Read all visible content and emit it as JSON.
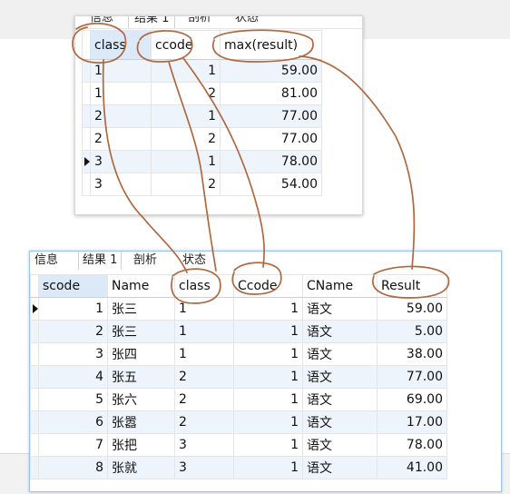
{
  "top_result": {
    "tabs": [
      "信息",
      "结果 1",
      "剖析",
      "状态"
    ],
    "columns": [
      "class",
      "ccode",
      "max(result)"
    ],
    "rows": [
      [
        "1",
        "1",
        "59.00"
      ],
      [
        "1",
        "2",
        "81.00"
      ],
      [
        "2",
        "1",
        "77.00"
      ],
      [
        "2",
        "2",
        "77.00"
      ],
      [
        "3",
        "1",
        "78.00"
      ],
      [
        "3",
        "2",
        "54.00"
      ]
    ],
    "current_row_index": 4
  },
  "bottom_result": {
    "tabs": [
      "信息",
      "结果 1",
      "剖析",
      "状态"
    ],
    "columns": [
      "scode",
      "Name",
      "class",
      "Ccode",
      "CName",
      "Result"
    ],
    "rows": [
      [
        "1",
        "张三",
        "1",
        "1",
        "语文",
        "59.00"
      ],
      [
        "2",
        "张三",
        "1",
        "1",
        "语文",
        "5.00"
      ],
      [
        "3",
        "张四",
        "1",
        "1",
        "语文",
        "38.00"
      ],
      [
        "4",
        "张五",
        "2",
        "1",
        "语文",
        "77.00"
      ],
      [
        "5",
        "张六",
        "2",
        "1",
        "语文",
        "69.00"
      ],
      [
        "6",
        "张嚣",
        "2",
        "1",
        "语文",
        "17.00"
      ],
      [
        "7",
        "张把",
        "3",
        "1",
        "语文",
        "78.00"
      ],
      [
        "8",
        "张就",
        "3",
        "1",
        "语文",
        "41.00"
      ]
    ],
    "current_row_index": 0
  },
  "annotation_color": "#b0683f"
}
